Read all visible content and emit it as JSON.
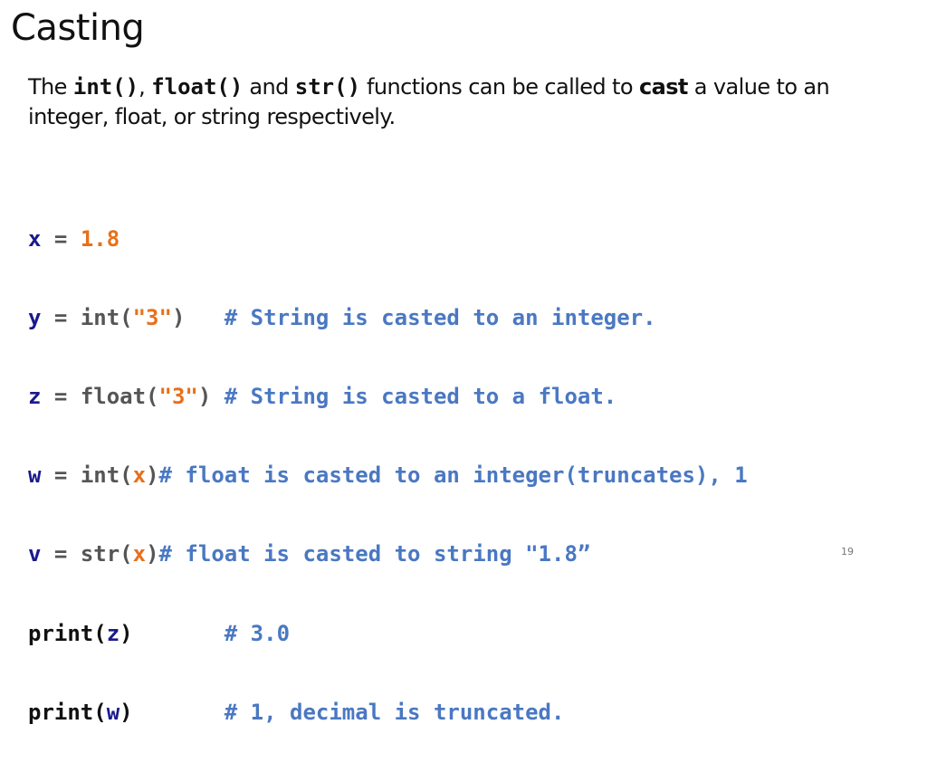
{
  "slide": {
    "title": "Casting",
    "intro": {
      "prefix": "The ",
      "fn1": "int()",
      "sep1": ", ",
      "fn2": "float()",
      "sep2": " and ",
      "fn3": "str()",
      "mid": " functions can be called to ",
      "bold_word": "cast",
      "suffix": " a value to an integer, float, or string respectively."
    },
    "code": [
      {
        "var": "x",
        "eq": " = ",
        "call": "",
        "open": "",
        "arg": "1.8",
        "close": "",
        "pad": "",
        "comment": ""
      },
      {
        "var": "y",
        "eq": " = ",
        "call": "int(",
        "open": "",
        "arg": "\"3\"",
        "close": ")",
        "pad": "   ",
        "comment": "# String is casted to an integer."
      },
      {
        "var": "z",
        "eq": " = ",
        "call": "float(",
        "open": "",
        "arg": "\"3\"",
        "close": ")",
        "pad": " ",
        "comment": "# String is casted to a float."
      },
      {
        "var": "w",
        "eq": " = ",
        "call": "int(",
        "open": "",
        "arg": "x",
        "close": ")",
        "pad": "",
        "comment": "# float is casted to an integer(truncates), 1"
      },
      {
        "var": "v",
        "eq": " = ",
        "call": "str(",
        "open": "",
        "arg": "x",
        "close": ")",
        "pad": "",
        "comment": "# float is casted to string \"1.8”"
      }
    ],
    "prints": [
      {
        "fn": "print(",
        "arg": "z",
        "close": ")",
        "pad": "       ",
        "comment": "# 3.0"
      },
      {
        "fn": "print(",
        "arg": "w",
        "close": ")",
        "pad": "       ",
        "comment": "# 1, decimal is truncated."
      }
    ],
    "page_number": "19"
  },
  "colors": {
    "variable": "#1a1a8c",
    "literal": "#e8701a",
    "comment": "#4a78c2",
    "text": "#111111"
  }
}
